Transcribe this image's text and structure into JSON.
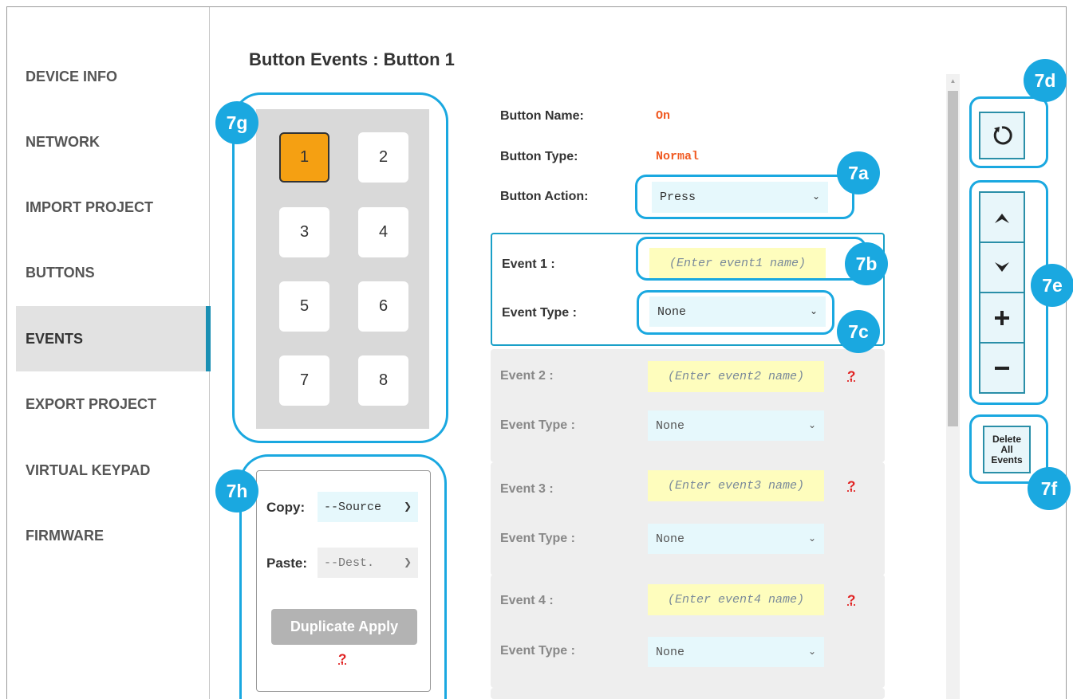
{
  "page_title": "Button Events : Button 1",
  "sidebar": {
    "items": [
      {
        "label": "DEVICE INFO"
      },
      {
        "label": "NETWORK"
      },
      {
        "label": "IMPORT PROJECT"
      },
      {
        "label": "BUTTONS"
      },
      {
        "label": "EVENTS",
        "active": true
      },
      {
        "label": "EXPORT PROJECT"
      },
      {
        "label": "VIRTUAL KEYPAD"
      },
      {
        "label": "FIRMWARE"
      }
    ]
  },
  "keypad": {
    "keys": [
      "1",
      "2",
      "3",
      "4",
      "5",
      "6",
      "7",
      "8"
    ],
    "selected": "1"
  },
  "copy_panel": {
    "copy_label": "Copy:",
    "copy_value": "--Source",
    "paste_label": "Paste:",
    "paste_value": "--Dest.",
    "duplicate_label": "Duplicate Apply",
    "help": "?"
  },
  "details": {
    "button_name_label": "Button Name:",
    "button_name_value": "On",
    "button_type_label": "Button Type:",
    "button_type_value": "Normal",
    "button_action_label": "Button Action:",
    "button_action_value": "Press"
  },
  "events": [
    {
      "label": "Event 1 :",
      "placeholder": "(Enter event1 name)",
      "type_label": "Event Type :",
      "type_value": "None"
    },
    {
      "label": "Event 2 :",
      "placeholder": "(Enter event2 name)",
      "type_label": "Event Type :",
      "type_value": "None",
      "help": "?"
    },
    {
      "label": "Event 3 :",
      "placeholder": "(Enter event3 name)",
      "type_label": "Event Type :",
      "type_value": "None",
      "help": "?"
    },
    {
      "label": "Event 4 :",
      "placeholder": "(Enter event4 name)",
      "type_label": "Event Type :",
      "type_value": "None",
      "help": "?"
    }
  ],
  "tools": {
    "refresh_icon": "refresh-icon",
    "up_icon": "chevron-up-icon",
    "down_icon": "chevron-down-icon",
    "add_icon": "plus-icon",
    "remove_icon": "minus-icon",
    "delete_all_line1": "Delete",
    "delete_all_line2": "All",
    "delete_all_line3": "Events"
  },
  "callouts": {
    "a": "7a",
    "b": "7b",
    "c": "7c",
    "d": "7d",
    "e": "7e",
    "f": "7f",
    "g": "7g",
    "h": "7h"
  },
  "colors": {
    "accent": "#1aa8e0",
    "selected_key": "#f5a012",
    "value_text": "#f05a22",
    "input_yellow": "#fefdbd",
    "select_blue": "#e6f8fc"
  }
}
